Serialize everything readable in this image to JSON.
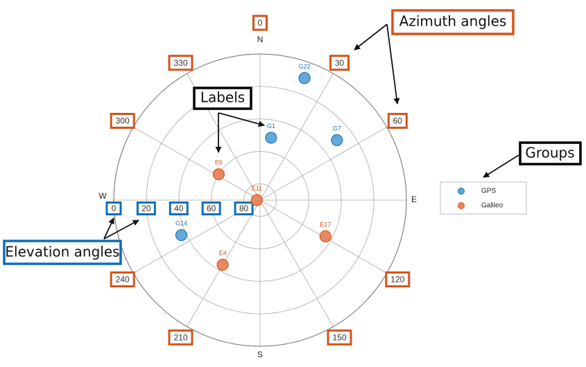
{
  "chart_data": {
    "type": "scatter",
    "subtype": "polar-skyplot",
    "title": "",
    "azimuth_ticks": [
      0,
      30,
      60,
      120,
      150,
      210,
      240,
      300,
      330
    ],
    "azimuth_labels": [
      "0",
      "30",
      "60",
      "120",
      "150",
      "210",
      "240",
      "300",
      "330"
    ],
    "elevation_ticks": [
      0,
      20,
      40,
      60,
      80
    ],
    "elevation_labels": [
      "0",
      "20",
      "40",
      "60",
      "80"
    ],
    "elevation_range": [
      0,
      90
    ],
    "cardinal_labels": {
      "N": "N",
      "E": "E",
      "S": "S",
      "W": "W"
    },
    "grid": true,
    "legend_position": "right",
    "series": [
      {
        "name": "GPS",
        "color": "#5BA3D9",
        "edge_color": "#1F77B4",
        "label_color": "#1F77B4",
        "points": [
          {
            "label": "G22",
            "azimuth": 20,
            "elevation": 10
          },
          {
            "label": "G1",
            "azimuth": 10,
            "elevation": 51
          },
          {
            "label": "G7",
            "azimuth": 52,
            "elevation": 30
          },
          {
            "label": "G14",
            "azimuth": 246,
            "elevation": 37
          }
        ]
      },
      {
        "name": "Galileo",
        "color": "#E8835A",
        "edge_color": "#D95319",
        "label_color": "#D95319",
        "points": [
          {
            "label": "E6",
            "azimuth": 302,
            "elevation": 60
          },
          {
            "label": "E11",
            "azimuth": 270,
            "elevation": 88
          },
          {
            "label": "E4",
            "azimuth": 210,
            "elevation": 44
          },
          {
            "label": "E17",
            "azimuth": 119,
            "elevation": 44
          }
        ]
      }
    ]
  },
  "annotations": {
    "azimuth": {
      "text": "Azimuth angles",
      "color": "#D55317"
    },
    "elevation": {
      "text": "Elevation angles",
      "color": "#0E6EB8"
    },
    "labels": {
      "text": "Labels",
      "color": "#000000"
    },
    "groups": {
      "text": "Groups",
      "color": "#000000"
    }
  },
  "legend": {
    "items": [
      {
        "label": "GPS"
      },
      {
        "label": "Galileo"
      }
    ]
  }
}
